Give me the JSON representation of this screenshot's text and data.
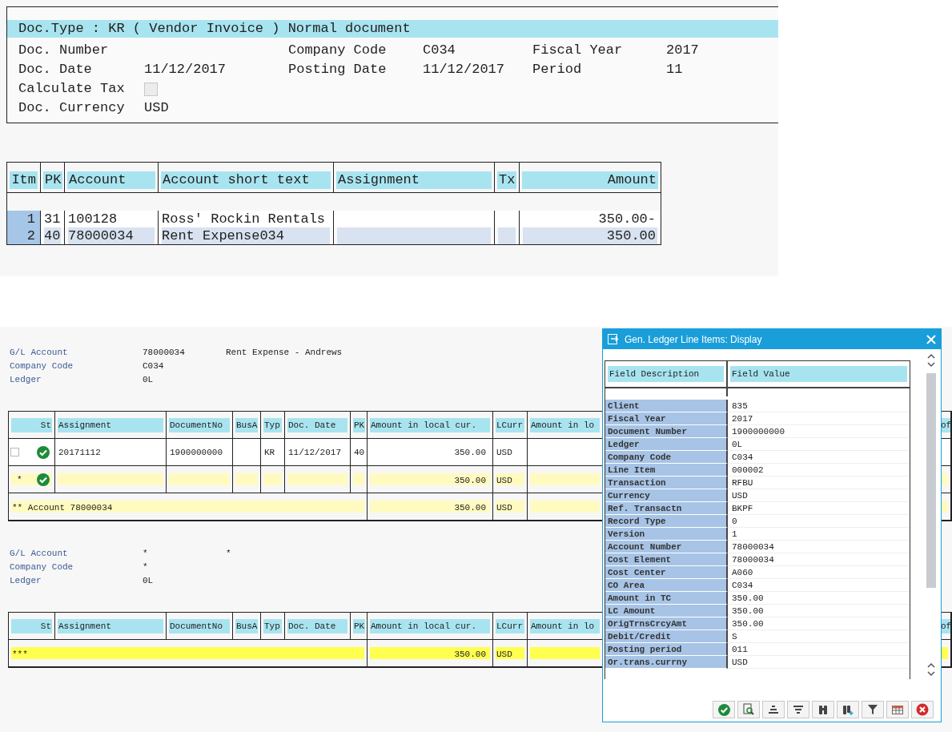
{
  "document_header": {
    "doc_type_line": "Doc.Type : KR ( Vendor Invoice ) Normal document",
    "rows": [
      [
        {
          "label": "Doc. Number"
        },
        {
          "label": "Company Code",
          "value": "C034"
        },
        {
          "label": "Fiscal Year",
          "value": "2017"
        }
      ],
      [
        {
          "label": "Doc. Date",
          "value": "11/12/2017"
        },
        {
          "label": "Posting Date",
          "value": "11/12/2017"
        },
        {
          "label": "Period",
          "value": "11"
        }
      ],
      [
        {
          "label": "Calculate Tax",
          "kind": "checkbox",
          "checked": false
        }
      ],
      [
        {
          "label": "Doc. Currency",
          "value": "USD"
        }
      ]
    ]
  },
  "items_table": {
    "columns": [
      "Itm",
      "PK",
      "Account",
      "Account short text",
      "Assignment",
      "Tx",
      "Amount"
    ],
    "rows": [
      {
        "itm": "1",
        "pk": "31",
        "account": "100128",
        "short_text": "Ross' Rockin Rentals",
        "amount": "350.00-",
        "selected": false
      },
      {
        "itm": "2",
        "pk": "40",
        "account": "78000034",
        "short_text": "Rent Expense034",
        "amount": "350.00",
        "selected": true
      }
    ]
  },
  "gl_blocks": [
    {
      "fields": [
        {
          "label": "G/L Account",
          "values": [
            "78000034",
            "Rent Expense - Andrews"
          ]
        },
        {
          "label": "Company Code",
          "values": [
            "C034"
          ]
        },
        {
          "label": "Ledger",
          "values": [
            "0L"
          ]
        }
      ],
      "table": {
        "columns": [
          "St",
          "Assignment",
          "DocumentNo",
          "BusA",
          "Typ",
          "Doc. Date",
          "PK",
          "Amount in local cur.",
          "LCurr",
          "Amount in lo",
          "of"
        ],
        "rows": [
          {
            "kind": "item",
            "checked": false,
            "status_ok": true,
            "cells": [
              "20171112",
              "1900000000",
              "",
              "KR",
              "11/12/2017",
              "40",
              "350.00",
              "USD"
            ]
          },
          {
            "kind": "subtotal",
            "marker": "*",
            "status_ok": true,
            "cells": [
              "",
              "",
              "",
              "",
              "",
              "",
              "350.00",
              "USD"
            ]
          },
          {
            "kind": "total",
            "text": "** Account 78000034",
            "amount": "350.00",
            "currency": "USD"
          }
        ]
      }
    },
    {
      "fields": [
        {
          "label": "G/L Account",
          "values": [
            "*",
            "*"
          ]
        },
        {
          "label": "Company Code",
          "values": [
            "*"
          ]
        },
        {
          "label": "Ledger",
          "values": [
            "0L"
          ]
        }
      ],
      "table": {
        "columns": [
          "St",
          "Assignment",
          "DocumentNo",
          "BusA",
          "Typ",
          "Doc. Date",
          "PK",
          "Amount in local cur.",
          "LCurr",
          "Amount in lo",
          "of"
        ],
        "rows": [
          {
            "kind": "grand_total",
            "text": "***",
            "amount": "350.00",
            "currency": "USD"
          }
        ]
      }
    }
  ],
  "popup": {
    "title": "Gen. Ledger Line Items: Display",
    "columns": [
      "Field Description",
      "Field Value"
    ],
    "rows": [
      {
        "label": "Client",
        "value": "835"
      },
      {
        "label": "Fiscal Year",
        "value": "2017"
      },
      {
        "label": "Document Number",
        "value": "1900000000"
      },
      {
        "label": "Ledger",
        "value": "0L"
      },
      {
        "label": "Company Code",
        "value": "C034"
      },
      {
        "label": "Line Item",
        "value": "000002"
      },
      {
        "label": "Transaction",
        "value": "RFBU"
      },
      {
        "label": "Currency",
        "value": "USD"
      },
      {
        "label": "Ref. Transactn",
        "value": "BKPF"
      },
      {
        "label": "Record Type",
        "value": "0"
      },
      {
        "label": "Version",
        "value": "1"
      },
      {
        "label": "Account Number",
        "value": "78000034"
      },
      {
        "label": "Cost Element",
        "value": "78000034"
      },
      {
        "label": "Cost Center",
        "value": "A060"
      },
      {
        "label": "CO Area",
        "value": "C034"
      },
      {
        "label": "Amount in TC",
        "value": "350.00"
      },
      {
        "label": "LC Amount",
        "value": "350.00"
      },
      {
        "label": "OrigTrnsCrcyAmt",
        "value": "350.00"
      },
      {
        "label": "Debit/Credit",
        "value": "S"
      },
      {
        "label": "Posting period",
        "value": "011"
      },
      {
        "label": "Or.trans.currny",
        "value": "USD"
      }
    ],
    "toolbar": [
      {
        "kind": "ok"
      },
      {
        "kind": "details"
      },
      {
        "kind": "sort_up"
      },
      {
        "kind": "sort_down"
      },
      {
        "kind": "find"
      },
      {
        "kind": "find_next"
      },
      {
        "kind": "filter"
      },
      {
        "kind": "layout"
      },
      {
        "kind": "cancel"
      }
    ]
  }
}
